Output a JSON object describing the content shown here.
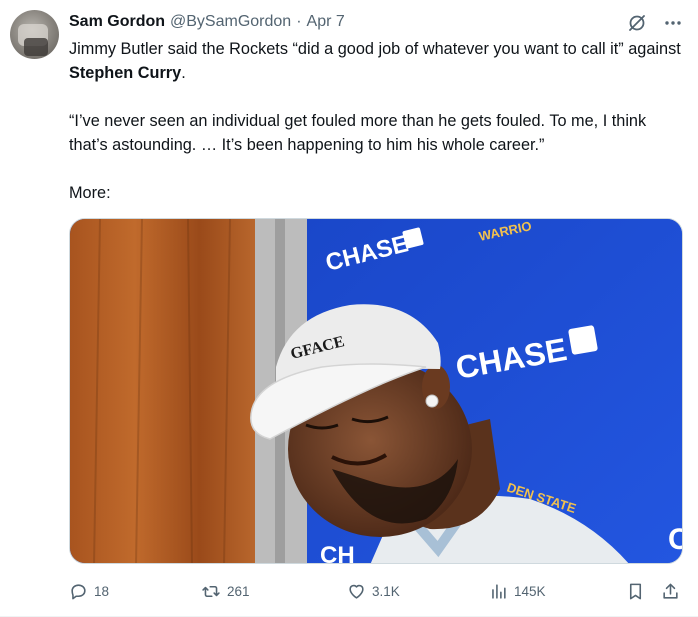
{
  "author": {
    "name": "Sam Gordon",
    "handle": "@BySamGordon",
    "separator": "·",
    "date": "Apr 7"
  },
  "tweet": {
    "line1_pre": "Jimmy Butler said the Rockets “did a good job of whatever you want to call it” against ",
    "line1_bold": "Stephen Curry",
    "line1_post": ".",
    "quote": "“I’ve never seen an individual get fouled more than he gets fouled. To me, I think that’s astounding. … It’s been happening to him his whole career.”",
    "more": "More:"
  },
  "media": {
    "backdrop_text_1": "CHASE",
    "backdrop_text_2": "CHASE",
    "backdrop_text_3": "CH",
    "backdrop_text_4": "C",
    "team_text_1": "WARRIO",
    "team_text_2": "DEN STATE",
    "cap_text": "GFACE"
  },
  "actions": {
    "replies": "18",
    "retweets": "261",
    "likes": "3.1K",
    "views": "145K"
  },
  "icons": {
    "reply": "reply-icon",
    "retweet": "retweet-icon",
    "like": "heart-icon",
    "views": "views-icon",
    "bookmark": "bookmark-icon",
    "share": "share-icon",
    "grok": "grok-icon",
    "more": "more-icon"
  },
  "colors": {
    "text": "#0f1419",
    "secondary": "#536471",
    "backdrop_blue": "#1d4fd6"
  }
}
